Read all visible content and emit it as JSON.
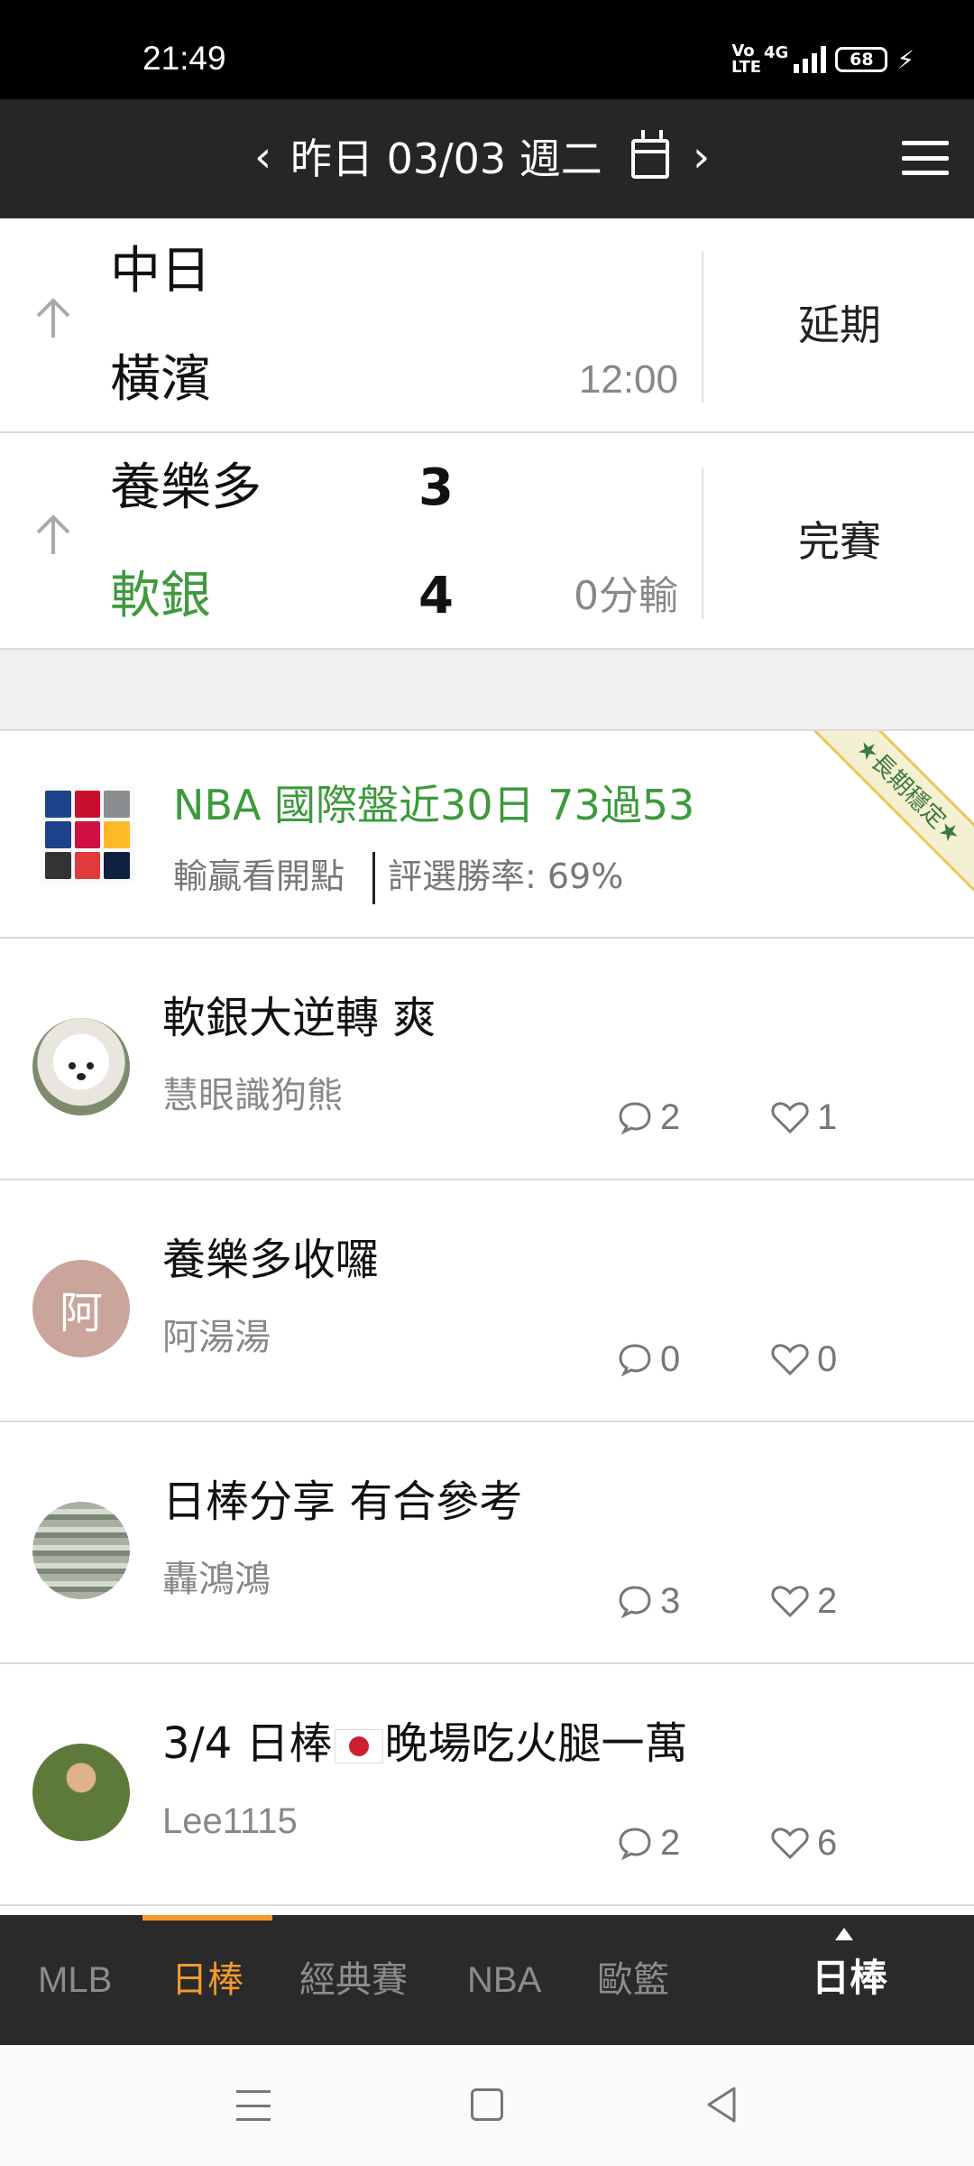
{
  "status_bar": {
    "time": "21:49",
    "volte": "Vo LTE",
    "network": "4G",
    "battery": "68"
  },
  "header": {
    "prev": "‹",
    "date": "昨日 03/03 週二",
    "next": "›"
  },
  "games": [
    {
      "team1": "中日",
      "team2": "橫濱",
      "score1": "",
      "score2": "",
      "meta": "12:00",
      "status": "延期",
      "winner": null
    },
    {
      "team1": "養樂多",
      "team2": "軟銀",
      "score1": "3",
      "score2": "4",
      "meta": "0分輸",
      "status": "完賽",
      "winner": "team2"
    }
  ],
  "ad": {
    "title": "NBA 國際盤近30日 73過53",
    "subtitle_left": "輸贏看開點",
    "subtitle_right": "評選勝率: 69%",
    "ribbon": "★長期穩定★",
    "colors": {
      "title": "#3d9a3d"
    }
  },
  "posts": [
    {
      "title": "軟銀大逆轉 爽",
      "author": "慧眼識狗熊",
      "comments": "2",
      "likes": "1",
      "avatar": "dog-photo"
    },
    {
      "title": "養樂多收囉",
      "author": "阿湯湯",
      "comments": "0",
      "likes": "0",
      "avatar_letter": "阿"
    },
    {
      "title": "日棒分享 有合參考",
      "author": "轟鴻鴻",
      "comments": "3",
      "likes": "2",
      "avatar": "money-photo"
    },
    {
      "title_before": "3/4 日棒",
      "title_after": "晚場吃火腿一萬",
      "author": "Lee1115",
      "comments": "2",
      "likes": "6",
      "avatar": "person-photo",
      "flag": "japan-flag-emoji"
    }
  ],
  "tabs": [
    {
      "label": "MLB",
      "active": false
    },
    {
      "label": "日棒",
      "active": true
    },
    {
      "label": "經典賽",
      "active": false
    },
    {
      "label": "NBA",
      "active": false
    },
    {
      "label": "歐籃",
      "active": false
    }
  ],
  "current_league": "日棒",
  "colors": {
    "accent": "#f39a2c",
    "winner": "#3d9a3d",
    "header_bg": "#262626",
    "tab_bg": "#2a2a2a"
  }
}
